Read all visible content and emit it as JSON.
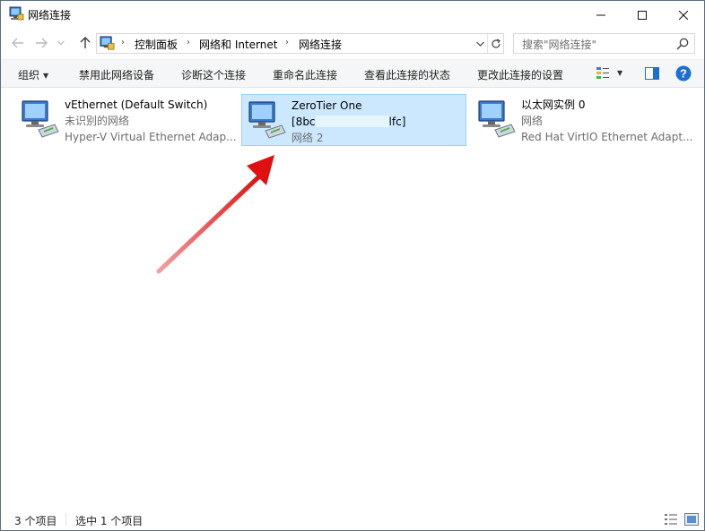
{
  "window": {
    "title": "网络连接",
    "controls": {
      "minimize": "minimize-icon",
      "maximize": "maximize-icon",
      "close": "close-icon"
    }
  },
  "address": {
    "crumbs": [
      "控制面板",
      "网络和 Internet",
      "网络连接"
    ],
    "search_placeholder": "搜索\"网络连接\""
  },
  "toolbar": {
    "organize": "组织",
    "disable_device": "禁用此网络设备",
    "diagnose": "诊断这个连接",
    "rename": "重命名此连接",
    "view_status": "查看此连接的状态",
    "change_settings": "更改此连接的设置"
  },
  "connections": [
    {
      "name": "vEthernet (Default Switch)",
      "status": "未识别的网络",
      "device": "Hyper-V Virtual Ethernet Adap...",
      "selected": false
    },
    {
      "name": "ZeroTier One",
      "status_start": "[8bc",
      "status_end": "lfc]",
      "device": "网络 2",
      "selected": true
    },
    {
      "name": "以太网实例 0",
      "status": "网络",
      "device": "Red Hat VirtIO Ethernet Adapt...",
      "selected": false
    }
  ],
  "status_bar": {
    "item_count": "3 个项目",
    "selected_count": "选中 1 个项目"
  },
  "colors": {
    "selection_bg": "#cce8ff",
    "selection_border": "#99d1ff",
    "annotation_arrow": "#e01010",
    "help_blue": "#1c6fd1"
  }
}
